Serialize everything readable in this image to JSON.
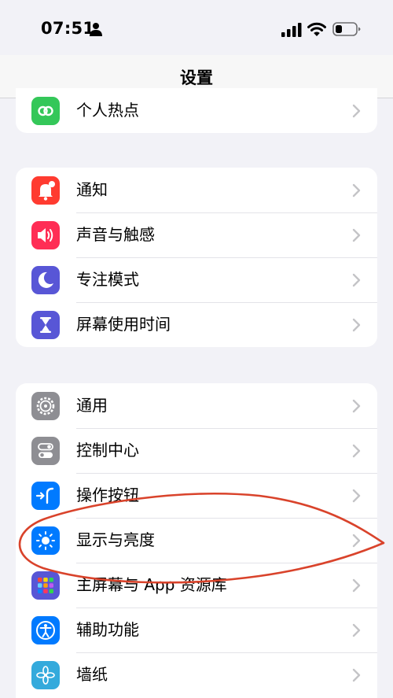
{
  "status": {
    "time": "07:51"
  },
  "nav": {
    "title": "设置"
  },
  "groups": [
    {
      "items": [
        {
          "label": "个人热点",
          "icon": "hotspot-icon",
          "color": "#34c759"
        }
      ]
    },
    {
      "items": [
        {
          "label": "通知",
          "icon": "bell-icon",
          "color": "#ff3b30"
        },
        {
          "label": "声音与触感",
          "icon": "speaker-icon",
          "color": "#ff2d55"
        },
        {
          "label": "专注模式",
          "icon": "moon-icon",
          "color": "#5856d6"
        },
        {
          "label": "屏幕使用时间",
          "icon": "hourglass-icon",
          "color": "#5856d6"
        }
      ]
    },
    {
      "items": [
        {
          "label": "通用",
          "icon": "gear-icon",
          "color": "#8e8e93"
        },
        {
          "label": "控制中心",
          "icon": "toggles-icon",
          "color": "#8e8e93"
        },
        {
          "label": "操作按钮",
          "icon": "action-button-icon",
          "color": "#007aff"
        },
        {
          "label": "显示与亮度",
          "icon": "sun-icon",
          "color": "#007aff"
        },
        {
          "label": "主屏幕与 App 资源库",
          "icon": "app-grid-icon",
          "color": "#5856d6"
        },
        {
          "label": "辅助功能",
          "icon": "accessibility-icon",
          "color": "#007aff"
        },
        {
          "label": "墙纸",
          "icon": "wallpaper-icon",
          "color": "#34aadc"
        }
      ]
    }
  ],
  "annotation": {
    "color": "#d9432b"
  }
}
